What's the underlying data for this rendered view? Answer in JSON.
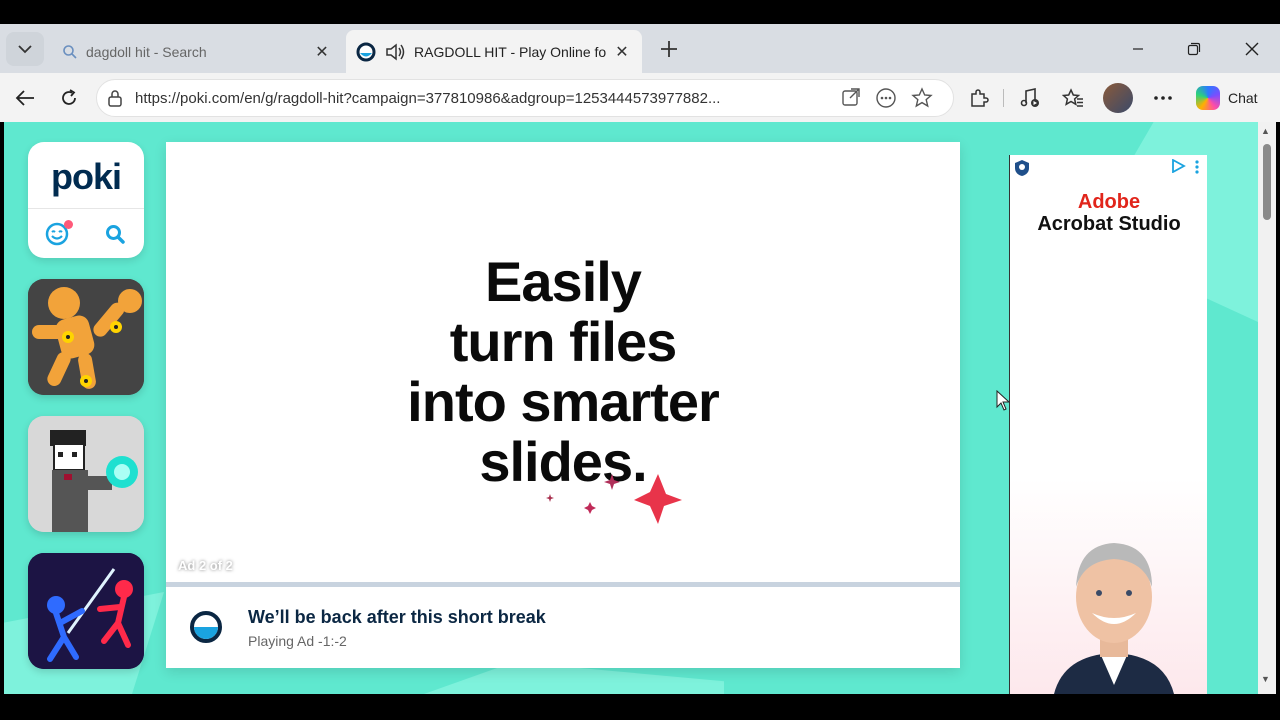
{
  "browser": {
    "tabs": [
      {
        "title": "dagdoll hit - Search",
        "active": false
      },
      {
        "title": "RAGDOLL HIT - Play Online fo",
        "active": true
      }
    ],
    "url": "https://poki.com/en/g/ragdoll-hit?campaign=377810986&adgroup=1253444573977882...",
    "chat_label": "Chat"
  },
  "sidebar": {
    "logo": "poki",
    "games": [
      "Ragdoll Hit",
      "Pixel Fighter",
      "Stickman Duel"
    ]
  },
  "game": {
    "headline_lines": [
      "Easily",
      "turn files",
      "into smarter",
      "slides."
    ],
    "ad_counter": "Ad 2 of 2",
    "break_title": "We’ll be back after this short break",
    "break_subtitle": "Playing Ad -1:-2"
  },
  "side_ad": {
    "brand": "Adobe",
    "product": "Acrobat Studio"
  },
  "colors": {
    "background": "#5fe8cf",
    "poki_navy": "#002b50",
    "adobe_red": "#e1251b"
  }
}
